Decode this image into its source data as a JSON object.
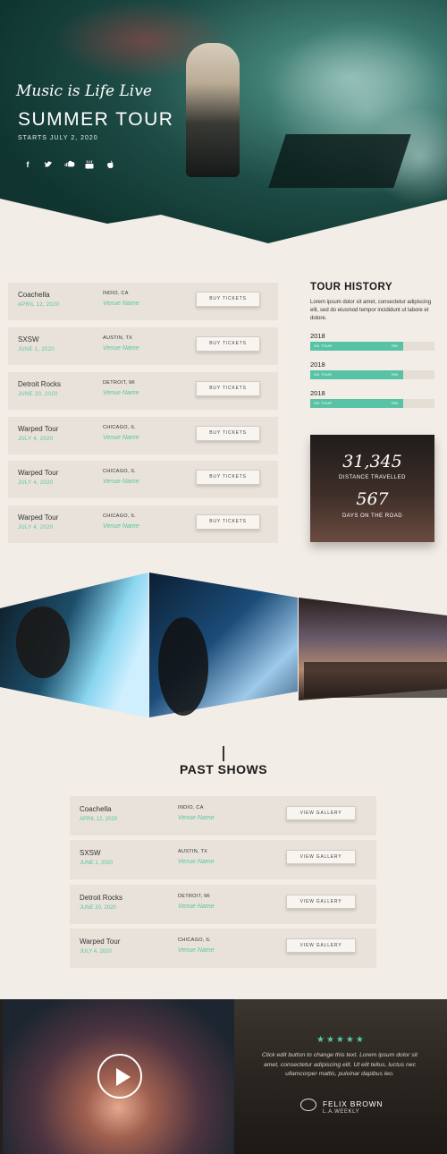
{
  "hero": {
    "script_title": "Music is Life Live",
    "title": "SUMMER TOUR",
    "subtitle": "STARTS JULY 2, 2020",
    "social_icons": [
      "facebook-icon",
      "twitter-icon",
      "soundcloud-icon",
      "youtube-icon",
      "apple-icon"
    ]
  },
  "tour": {
    "button_label": "BUY TICKETS",
    "rows": [
      {
        "name": "Coachella",
        "date": "APRIL 12, 2020",
        "city": "INDIO, CA",
        "venue": "Venue Name"
      },
      {
        "name": "SXSW",
        "date": "JUNE 1, 2020",
        "city": "AUSTIN, TX",
        "venue": "Venue Name"
      },
      {
        "name": "Detroit Rocks",
        "date": "JUNE 20, 2020",
        "city": "DETROIT, MI",
        "venue": "Venue Name"
      },
      {
        "name": "Warped Tour",
        "date": "JULY 4, 2020",
        "city": "CHICAGO, IL",
        "venue": "Venue Name"
      },
      {
        "name": "Warped Tour",
        "date": "JULY 4, 2020",
        "city": "CHICAGO, IL",
        "venue": "Venue Name"
      },
      {
        "name": "Warped Tour",
        "date": "JULY 4, 2020",
        "city": "CHICAGO, IL",
        "venue": "Venue Name"
      }
    ]
  },
  "history": {
    "title": "TOUR HISTORY",
    "text": "Lorem ipsum dolor sit amet, consectetur adipiscing elit, sed do eiusmod tempor incididunt ut labore et dolore.",
    "bars": [
      {
        "year": "2018",
        "label": "ON TOUR",
        "percent_text": "75%",
        "value": 0.75
      },
      {
        "year": "2018",
        "label": "ON TOUR",
        "percent_text": "75%",
        "value": 0.75
      },
      {
        "year": "2018",
        "label": "ON TOUR",
        "percent_text": "75%",
        "value": 0.75
      }
    ]
  },
  "stats": {
    "distance_value": "31,345",
    "distance_label": "DISTANCE TRAVELLED",
    "days_value": "567",
    "days_label": "DAYS ON THE ROAD"
  },
  "past": {
    "title": "PAST SHOWS",
    "button_label": "VIEW GALLERY",
    "rows": [
      {
        "name": "Coachella",
        "date": "APRIL 12, 2020",
        "city": "INDIO, CA",
        "venue": "Venue Name"
      },
      {
        "name": "SXSW",
        "date": "JUNE 1, 2020",
        "city": "AUSTIN, TX",
        "venue": "Venue Name"
      },
      {
        "name": "Detroit Rocks",
        "date": "JUNE 20, 2020",
        "city": "DETROIT, MI",
        "venue": "Venue Name"
      },
      {
        "name": "Warped Tour",
        "date": "JULY 4, 2020",
        "city": "CHICAGO, IL",
        "venue": "Venue Name"
      }
    ]
  },
  "testimonial": {
    "stars": "★★★★★",
    "quote": "Click edit button to change this text. Lorem ipsum dolor sit amet, consectetur adipiscing elit. Ut elit tellus, luctus nec ullamcorper mattis, pulvinar dapibus leo.",
    "author": "FELIX BROWN",
    "org": "L.A.WEEKLY"
  },
  "colors": {
    "accent": "#56c6a4",
    "background": "#f2ede7",
    "row": "#e8e2da"
  }
}
